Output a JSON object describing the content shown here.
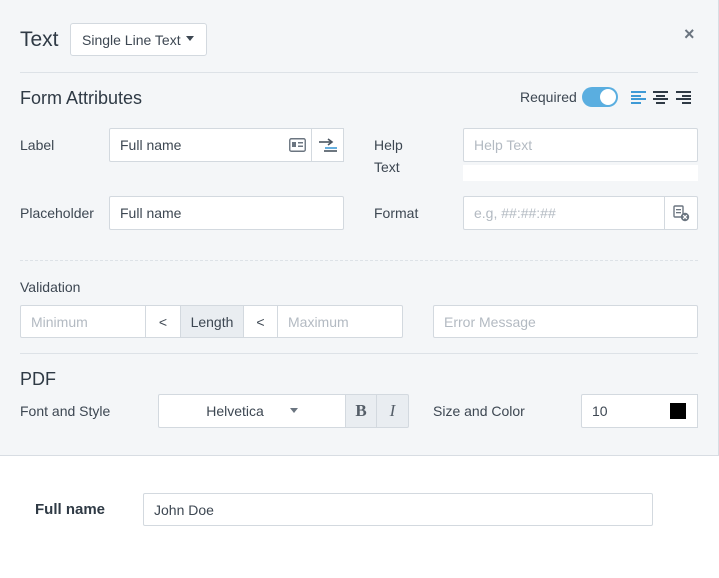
{
  "header": {
    "title": "Text",
    "field_type": "Single Line Text",
    "close_glyph": "×"
  },
  "form_attributes": {
    "title": "Form Attributes",
    "required_label": "Required",
    "required_on": true,
    "alignment_selected": "left",
    "label": {
      "label": "Label",
      "value": "Full name"
    },
    "help": {
      "label_line1": "Help",
      "label_line2": "Text",
      "placeholder": "Help Text",
      "value": ""
    },
    "placeholder": {
      "label": "Placeholder",
      "value": "Full name"
    },
    "format": {
      "label": "Format",
      "placeholder": "e.g, ##:##:##",
      "value": ""
    }
  },
  "validation": {
    "label": "Validation",
    "min_placeholder": "Minimum",
    "lt1": "<",
    "middle": "Length",
    "lt2": "<",
    "max_placeholder": "Maximum",
    "error_placeholder": "Error Message"
  },
  "pdf": {
    "title": "PDF",
    "font_style_label": "Font and Style",
    "font": "Helvetica",
    "bold_glyph": "B",
    "italic_glyph": "I",
    "size_color_label": "Size and Color",
    "size": "10",
    "color": "#000000"
  },
  "preview": {
    "label": "Full name",
    "value": "John Doe"
  },
  "colors": {
    "accent": "#5aaee0",
    "panel_bg": "#f4f6f8"
  }
}
